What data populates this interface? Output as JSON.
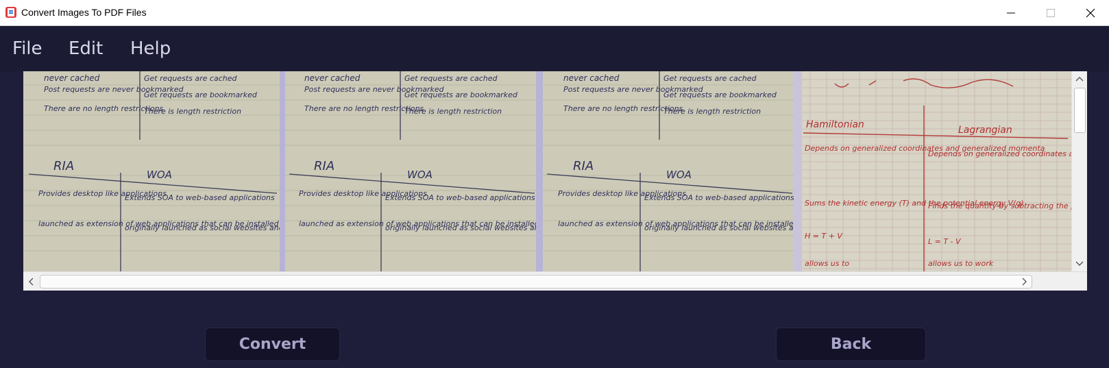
{
  "window": {
    "title": "Convert Images To PDF Files",
    "controls": {
      "minimize": "minimize-icon",
      "maximize": "maximize-icon",
      "close": "close-icon"
    }
  },
  "menu": {
    "items": [
      {
        "label": "File"
      },
      {
        "label": "Edit"
      },
      {
        "label": "Help"
      }
    ]
  },
  "viewer": {
    "images": [
      {
        "name": "notes-page-1",
        "content": "handwritten-notes-RIA-WOA"
      },
      {
        "name": "notes-page-2",
        "content": "handwritten-notes-RIA-WOA"
      },
      {
        "name": "notes-page-3",
        "content": "handwritten-notes-RIA-WOA"
      },
      {
        "name": "notes-page-4",
        "content": "handwritten-notes-Hamiltonian-Lagrangian"
      }
    ],
    "handwriting": {
      "top_left_1": "never cached",
      "top_left_2": "Post requests are never bookmarked",
      "top_left_3": "There are no length restrictions",
      "top_right_1": "Get requests are cached",
      "top_right_2": "Get requests are bookmarked",
      "top_right_3": "There is length restriction",
      "col_a": "RIA",
      "col_b": "WOA",
      "a1": "Provides desktop like applications",
      "a2": "launched as extension of web applications that can be installed",
      "b1": "Extends SOA to web-based applications",
      "b2": "originally launched as social websites and personal websites",
      "h_title_a": "Hamiltonian",
      "h_title_b": "Lagrangian",
      "h_a1": "Depends on generalized coordinates and generalized momenta",
      "h_a2": "Sums the kinetic energy (T) and the potential energy V(q)",
      "h_a3": "H = T + V",
      "h_a4": "allows us to",
      "h_b1": "Depends on generalized coordinates and generalized velocities",
      "h_b2": "Finds the quantity by subtracting the potential energy from the kinetic energy",
      "h_b3": "L = T - V",
      "h_b4": "allows us to work"
    }
  },
  "buttons": {
    "convert": "Convert",
    "back": "Back"
  },
  "colors": {
    "background": "#1e1d3a",
    "menubar": "#1c1b34",
    "button_bg": "#131228",
    "button_text": "#a7a5c8",
    "menu_text": "#d9d8e8"
  }
}
